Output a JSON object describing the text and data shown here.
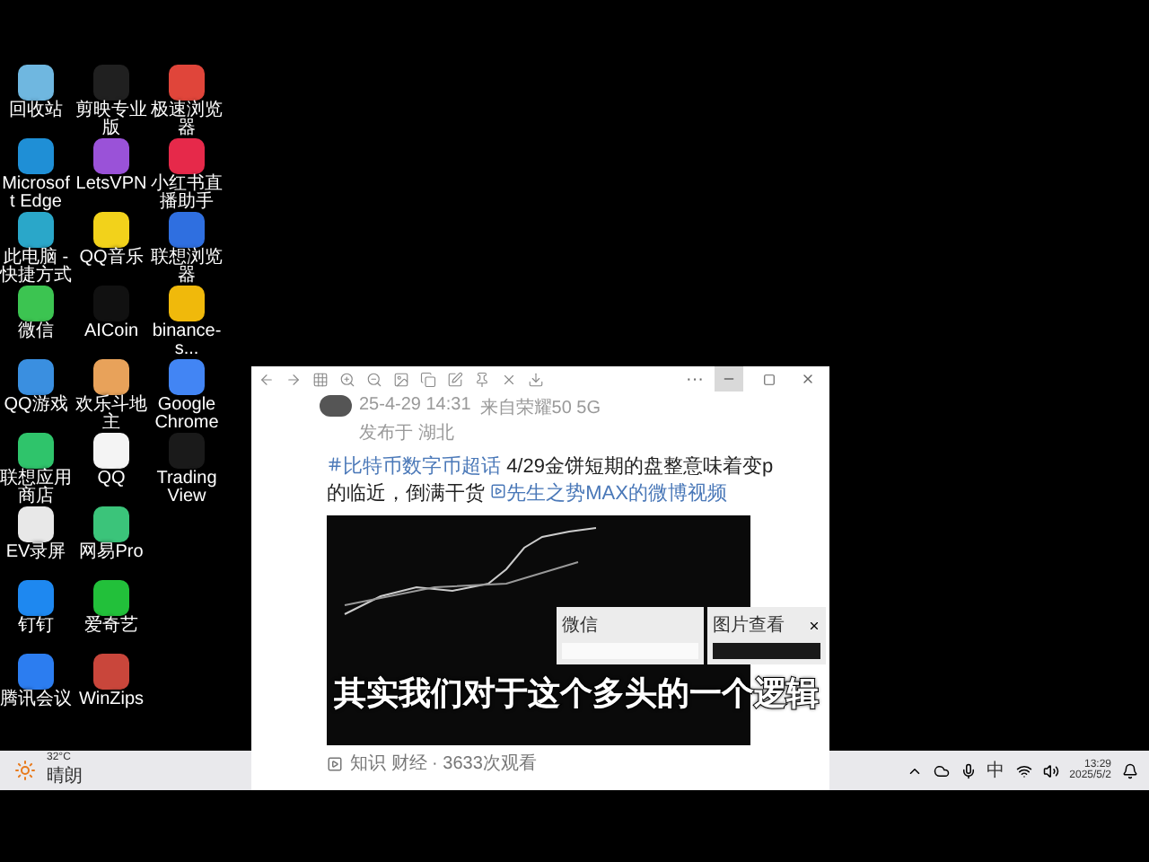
{
  "desktop_icons": [
    {
      "label": "回收站",
      "color": "#6fb7e0"
    },
    {
      "label": "Microsoft Edge",
      "color": "#1f8fd6"
    },
    {
      "label": "此电脑 - 快捷方式",
      "color": "#2aa7c9"
    },
    {
      "label": "微信",
      "color": "#3cc451"
    },
    {
      "label": "QQ游戏",
      "color": "#3a8fe0"
    },
    {
      "label": "联想应用商店",
      "color": "#2fc46b"
    },
    {
      "label": "EV录屏",
      "color": "#e8e8e8"
    },
    {
      "label": "钉钉",
      "color": "#1e88f0"
    },
    {
      "label": "腾讯会议",
      "color": "#2c7df0"
    },
    {
      "label": "剪映专业版",
      "color": "#202020"
    },
    {
      "label": "LetsVPN",
      "color": "#9a52d8"
    },
    {
      "label": "QQ音乐",
      "color": "#f2d21b"
    },
    {
      "label": "AICoin",
      "color": "#111111"
    },
    {
      "label": "欢乐斗地主",
      "color": "#e8a25a"
    },
    {
      "label": "QQ",
      "color": "#f4f4f4"
    },
    {
      "label": "网易Pro",
      "color": "#3bc47a"
    },
    {
      "label": "爱奇艺",
      "color": "#22c03a"
    },
    {
      "label": "WinZips",
      "color": "#c9463b"
    },
    {
      "label": "极速浏览器",
      "color": "#e0453a"
    },
    {
      "label": "小红书直播助手",
      "color": "#e6294a"
    },
    {
      "label": "联想浏览器",
      "color": "#2f6fe0"
    },
    {
      "label": "binance-s...",
      "color": "#f0b90b"
    },
    {
      "label": "Google Chrome",
      "color": "#4285f4"
    },
    {
      "label": "TradingView",
      "color": "#1a1a1a"
    }
  ],
  "window": {
    "more": "···",
    "post": {
      "time": "25-4-29 14:31",
      "source": "来自荣耀50 5G",
      "location": "发布于 湖北",
      "hashtag": "比特币数字币超话",
      "text": "4/29金饼短期的盘整意味着变p的临近，倒满干货",
      "video_link": "先生之势MAX的微博视频",
      "tags": "知识 财经 · 3633次观看"
    }
  },
  "previews": [
    {
      "title": "微信"
    },
    {
      "title": "图片查看"
    }
  ],
  "subtitle": "其实我们对于这个多头的一个逻辑",
  "taskbar": {
    "temperature": "32°C",
    "weather": "晴朗",
    "ime": "中",
    "time": "13:29",
    "date": "2025/5/2"
  }
}
